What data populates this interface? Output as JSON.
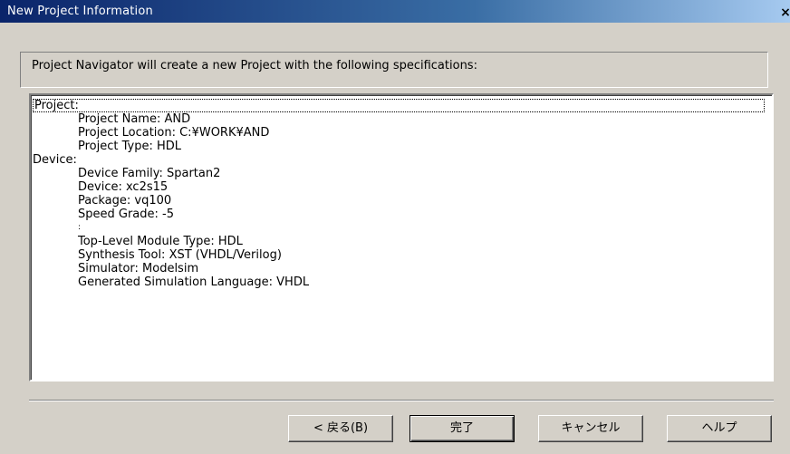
{
  "window": {
    "title": "New Project Information",
    "close_label": "×"
  },
  "header": {
    "text": "Project Navigator will create a new Project with the following specifications:"
  },
  "summary": {
    "project_heading": "Project:",
    "project_items": [
      "Project Name: AND",
      "Project Location: C:¥WORK¥AND",
      "Project Type: HDL"
    ],
    "device_heading": "Device:",
    "device_items": [
      "Device Family: Spartan2",
      "Device: xc2s15",
      "Package: vq100",
      "Speed Grade: -5",
      ":",
      "Top-Level Module Type: HDL",
      "Synthesis Tool: XST (VHDL/Verilog)",
      "Simulator: Modelsim",
      "Generated Simulation Language: VHDL"
    ]
  },
  "buttons": {
    "back": "< 戻る(B)",
    "finish": "完了",
    "cancel": "キャンセル",
    "help": "ヘルプ"
  }
}
